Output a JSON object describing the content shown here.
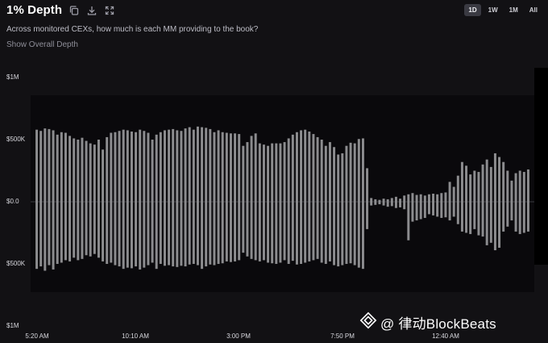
{
  "header": {
    "title": "1% Depth",
    "subtitle": "Across monitored CEXs, how much is each MM providing to the book?",
    "overall_link": "Show Overall Depth",
    "icons": [
      "copy-icon",
      "download-icon",
      "expand-icon"
    ]
  },
  "range_tabs": [
    {
      "label": "1D",
      "active": true
    },
    {
      "label": "1W",
      "active": false
    },
    {
      "label": "1M",
      "active": false
    },
    {
      "label": "All",
      "active": false
    }
  ],
  "watermark": {
    "text": "@ 律动BlockBeats",
    "logo": "blockbeats-diamond-logo"
  },
  "chart_data": {
    "type": "bar",
    "y_ticks": [
      "$1M",
      "$500K",
      "$0.0",
      "$500K",
      "$1M"
    ],
    "x_ticks": [
      "5:20 AM",
      "10:10 AM",
      "3:00 PM",
      "7:50 PM",
      "12:40 AM"
    ],
    "ylim": [
      -1000000,
      1000000
    ],
    "bar_color": "#8c8c8f",
    "series": [
      {
        "values": [
          580000,
          570000,
          590000,
          585000,
          575000,
          540000,
          560000,
          555000,
          530000,
          510000,
          500000,
          515000,
          490000,
          470000,
          460000,
          500000,
          420000,
          520000,
          555000,
          560000,
          570000,
          580000,
          575000,
          565000,
          560000,
          580000,
          570000,
          555000,
          500000,
          540000,
          560000,
          575000,
          580000,
          585000,
          575000,
          570000,
          590000,
          600000,
          580000,
          605000,
          600000,
          595000,
          585000,
          560000,
          575000,
          560000,
          555000,
          550000,
          550000,
          545000,
          450000,
          480000,
          530000,
          550000,
          470000,
          460000,
          450000,
          470000,
          470000,
          470000,
          480000,
          510000,
          540000,
          560000,
          575000,
          580000,
          565000,
          545000,
          520000,
          500000,
          450000,
          480000,
          440000,
          380000,
          390000,
          450000,
          475000,
          470000,
          505000,
          510000,
          270000,
          30000,
          20000,
          15000,
          25000,
          20000,
          30000,
          40000,
          25000,
          50000,
          60000,
          70000,
          55000,
          60000,
          50000,
          60000,
          65000,
          60000,
          70000,
          75000,
          160000,
          120000,
          210000,
          320000,
          290000,
          220000,
          250000,
          240000,
          300000,
          340000,
          280000,
          390000,
          360000,
          320000,
          250000,
          170000,
          230000,
          250000,
          240000,
          260000
        ]
      },
      {
        "values": [
          -540000,
          -520000,
          -555000,
          -510000,
          -545000,
          -500000,
          -490000,
          -470000,
          -480000,
          -450000,
          -470000,
          -460000,
          -430000,
          -440000,
          -420000,
          -450000,
          -480000,
          -500000,
          -490000,
          -510000,
          -520000,
          -540000,
          -530000,
          -535000,
          -520000,
          -545000,
          -530000,
          -510000,
          -490000,
          -540000,
          -500000,
          -515000,
          -510000,
          -520000,
          -525000,
          -515000,
          -520000,
          -505000,
          -500000,
          -510000,
          -540000,
          -520000,
          -505000,
          -510000,
          -500000,
          -495000,
          -480000,
          -485000,
          -480000,
          -470000,
          -410000,
          -440000,
          -460000,
          -470000,
          -480000,
          -470000,
          -490000,
          -495000,
          -500000,
          -490000,
          -470000,
          -500000,
          -475000,
          -505000,
          -500000,
          -490000,
          -480000,
          -470000,
          -460000,
          -490000,
          -500000,
          -480000,
          -510000,
          -520000,
          -510000,
          -500000,
          -495000,
          -510000,
          -530000,
          -540000,
          -220000,
          -30000,
          -25000,
          -20000,
          -30000,
          -40000,
          -35000,
          -50000,
          -45000,
          -60000,
          -310000,
          -160000,
          -150000,
          -140000,
          -130000,
          -100000,
          -110000,
          -120000,
          -130000,
          -125000,
          -150000,
          -120000,
          -180000,
          -240000,
          -250000,
          -260000,
          -220000,
          -270000,
          -280000,
          -350000,
          -330000,
          -390000,
          -370000,
          -240000,
          -200000,
          -150000,
          -240000,
          -260000,
          -250000,
          -240000
        ]
      }
    ]
  }
}
